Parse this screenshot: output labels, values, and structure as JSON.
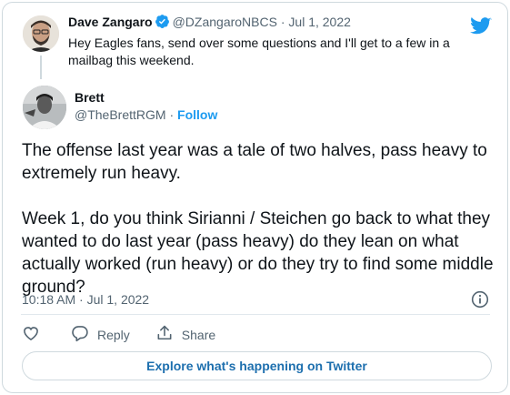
{
  "parent": {
    "name": "Dave Zangaro",
    "handle": "@DZangaroNBCS",
    "separator": "·",
    "date": "Jul 1, 2022",
    "text": "Hey Eagles fans, send over some questions and I'll get to a few in a mailbag this weekend."
  },
  "main": {
    "name": "Brett",
    "handle": "@TheBrettRGM",
    "separator": "·",
    "follow_label": "Follow",
    "text": "The offense last year was a tale of two halves, pass heavy to extremely run heavy.\n\nWeek 1, do you think Sirianni / Steichen go back to what they wanted to do last year (pass heavy) do they lean on what actually worked (run heavy) or do they try to find some middle ground?",
    "timestamp": "10:18 AM · Jul 1, 2022"
  },
  "actions": {
    "reply_label": "Reply",
    "share_label": "Share"
  },
  "explore_label": "Explore what's happening on Twitter",
  "colors": {
    "accent": "#1d9bf0",
    "text": "#0f1419",
    "muted": "#536471",
    "border": "#cfd9de"
  },
  "icons": [
    "verified-icon",
    "twitter-bird-icon",
    "info-icon",
    "heart-icon",
    "reply-icon",
    "share-icon"
  ]
}
